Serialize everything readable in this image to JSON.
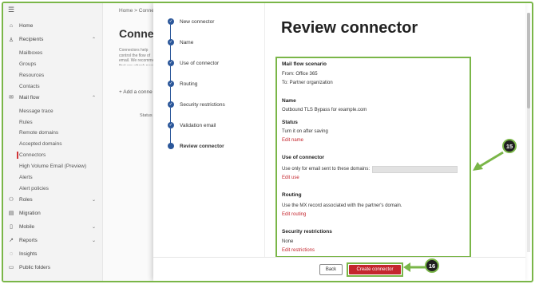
{
  "nav": {
    "items": [
      {
        "label": "Home",
        "icon": "home-icon",
        "glyph": "⌂",
        "sub": false,
        "chevron": ""
      },
      {
        "label": "Recipients",
        "icon": "person-icon",
        "glyph": "♙",
        "sub": false,
        "chevron": "⌃"
      },
      {
        "label": "Mailboxes",
        "sub": true
      },
      {
        "label": "Groups",
        "sub": true
      },
      {
        "label": "Resources",
        "sub": true
      },
      {
        "label": "Contacts",
        "sub": true
      },
      {
        "label": "Mail flow",
        "icon": "mail-icon",
        "glyph": "✉",
        "sub": false,
        "chevron": "⌃"
      },
      {
        "label": "Message trace",
        "sub": true
      },
      {
        "label": "Rules",
        "sub": true
      },
      {
        "label": "Remote domains",
        "sub": true
      },
      {
        "label": "Accepted domains",
        "sub": true
      },
      {
        "label": "Connectors",
        "sub": true,
        "active": true
      },
      {
        "label": "High Volume Email (Preview)",
        "sub": true
      },
      {
        "label": "Alerts",
        "sub": true
      },
      {
        "label": "Alert policies",
        "sub": true
      },
      {
        "label": "Roles",
        "icon": "roles-icon",
        "glyph": "⚇",
        "sub": false,
        "chevron": "⌄"
      },
      {
        "label": "Migration",
        "icon": "migration-icon",
        "glyph": "▤",
        "sub": false,
        "chevron": ""
      },
      {
        "label": "Mobile",
        "icon": "mobile-icon",
        "glyph": "▯",
        "sub": false,
        "chevron": "⌄"
      },
      {
        "label": "Reports",
        "icon": "reports-icon",
        "glyph": "↗",
        "sub": false,
        "chevron": "⌄"
      },
      {
        "label": "Insights",
        "icon": "insights-icon",
        "glyph": "◌",
        "sub": false,
        "chevron": ""
      },
      {
        "label": "Public folders",
        "icon": "folder-icon",
        "glyph": "▭",
        "sub": false,
        "chevron": ""
      }
    ]
  },
  "background": {
    "breadcrumb": "Home  >  Conne",
    "title": "Connecto",
    "description": "Connectors help control the flow of email. We recommend that you check need to use them.",
    "add_connector": "+ Add a conne",
    "status_col": "Status"
  },
  "wizard": {
    "steps": [
      {
        "label": "New connector",
        "done": true
      },
      {
        "label": "Name",
        "done": true
      },
      {
        "label": "Use of connector",
        "done": true
      },
      {
        "label": "Routing",
        "done": true
      },
      {
        "label": "Security restrictions",
        "done": true
      },
      {
        "label": "Validation email",
        "done": true
      },
      {
        "label": "Review connector",
        "done": false
      }
    ],
    "heading": "Review connector",
    "summary": {
      "mail_flow_title": "Mail flow scenario",
      "from": "From: Office 365",
      "to": "To: Partner organization",
      "name_title": "Name",
      "name_value": "Outbound TLS Bypass for example.com",
      "status_title": "Status",
      "status_value": "Turn it on after saving",
      "edit_name": "Edit name",
      "use_title": "Use of connector",
      "use_value": "Use only for email sent to these domains:",
      "edit_use": "Edit use",
      "routing_title": "Routing",
      "routing_value": "Use the MX record associated with the partner's domain.",
      "edit_routing": "Edit routing",
      "security_title": "Security restrictions",
      "security_value": "None",
      "edit_restrictions": "Edit restrictions"
    },
    "back_label": "Back",
    "create_label": "Create connector"
  },
  "callouts": {
    "first": "15",
    "second": "16"
  },
  "colors": {
    "accent_red": "#c4262e",
    "highlight_green": "#7ab648",
    "step_blue": "#2b579a"
  }
}
